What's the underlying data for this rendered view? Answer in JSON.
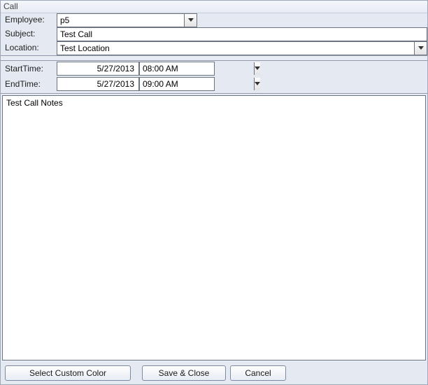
{
  "window": {
    "title": "Call"
  },
  "labels": {
    "employee": "Employee:",
    "subject": "Subject:",
    "location": "Location:",
    "starttime": "StartTime:",
    "endtime": "EndTime:"
  },
  "fields": {
    "employee": "p5",
    "subject": "Test Call",
    "location": "Test Location",
    "start_date": "5/27/2013",
    "start_time": "08:00 AM",
    "end_date": "5/27/2013",
    "end_time": "09:00 AM",
    "notes": "Test Call Notes"
  },
  "buttons": {
    "select_color": "Select Custom Color",
    "save_close": "Save & Close",
    "cancel": "Cancel"
  }
}
